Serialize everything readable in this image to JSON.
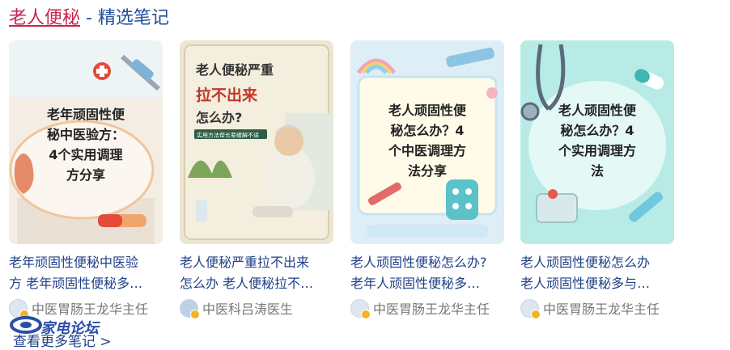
{
  "header": {
    "keyword": "老人便秘",
    "separator": " - ",
    "section": "精选笔记"
  },
  "cards": [
    {
      "cover_lines": [
        "老年顽固性便",
        "秘中医验方：",
        "4个实用调理",
        "方分享"
      ],
      "title_line1": "老年顽固性便秘中医验",
      "title_line2": "方 老年顽固性便秘多…",
      "author": "中医胃肠王龙华主任"
    },
    {
      "cover_lines": [
        "老人便秘严重",
        "拉不出来",
        "怎么办?"
      ],
      "cover_sub": "实用方法帮长辈缓解不适",
      "title_line1": "老人便秘严重拉不出来",
      "title_line2": "怎么办 老人便秘拉不…",
      "author": "中医科吕涛医生"
    },
    {
      "cover_lines": [
        "老人顽固性便",
        "秘怎么办？4",
        "个中医调理方",
        "法分享"
      ],
      "title_line1": "老人顽固性便秘怎么办?",
      "title_line2": "老年人顽固性便秘多…",
      "author": "中医胃肠王龙华主任"
    },
    {
      "cover_lines": [
        "老人顽固性便",
        "秘怎么办？4",
        "个实用调理方",
        "法"
      ],
      "title_line1": "老人顽固性便秘怎么办",
      "title_line2": "老人顽固性便秘多与…",
      "author": "中医胃肠王龙华主任"
    }
  ],
  "more_link": "查看更多笔记 >",
  "watermark": "家电论坛",
  "colors": {
    "link_blue": "#1f3f86",
    "keyword_red": "#c7254e",
    "meta_gray": "#777777"
  }
}
